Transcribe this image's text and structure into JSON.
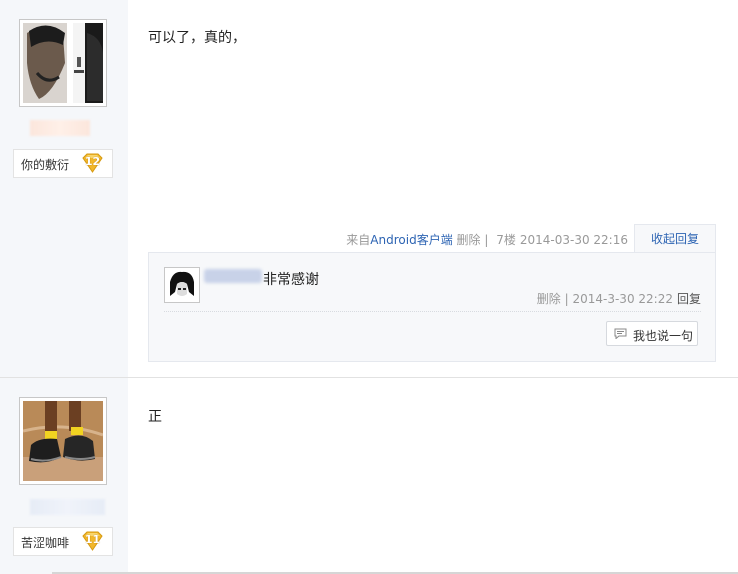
{
  "posts": [
    {
      "badge": {
        "name": "你的敷衍",
        "level": "12"
      },
      "content": "可以了，真的，",
      "tail": {
        "source_prefix": "来自",
        "source_link": "Android客户端",
        "delete": "删除",
        "floor": "7楼",
        "date": "2014-03-30 22:16",
        "collapse": "收起回复"
      },
      "replies": [
        {
          "text": "非常感谢",
          "meta": "删除 | 2014-3-30 22:22",
          "reply_label": "回复"
        }
      ],
      "say_button": "我也说一句"
    },
    {
      "badge": {
        "name": "苦涩咖啡",
        "level": "11"
      },
      "content": "正"
    }
  ],
  "colors": {
    "link": "#2d64b3",
    "sidebar": "#f5f7fa",
    "badge_gold": "#f2b72b"
  }
}
